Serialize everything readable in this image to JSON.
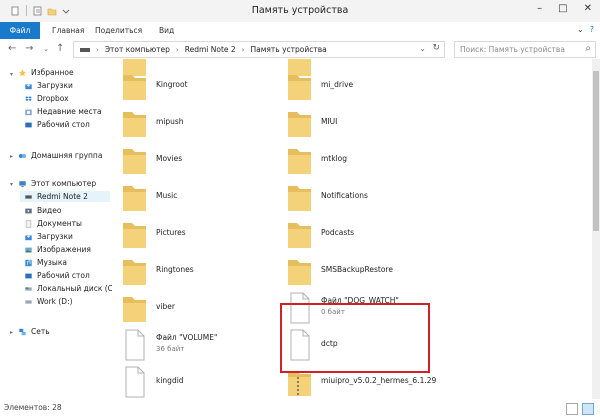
{
  "window": {
    "title": "Память устройства"
  },
  "ribbon": {
    "tabs": [
      "Файл",
      "Главная",
      "Поделиться",
      "Вид"
    ]
  },
  "address": {
    "crumbs": [
      "Этот компьютер",
      "Redmi Note 2",
      "Память устройства"
    ],
    "search_placeholder": "Поиск: Память устройства"
  },
  "nav": {
    "favorites": "Избранное",
    "fav_items": [
      "Загрузки",
      "Dropbox",
      "Недавние места",
      "Рабочий стол"
    ],
    "homegroup": "Домашняя группа",
    "computer": "Этот компьютер",
    "computer_items": [
      "Redmi Note 2",
      "Видео",
      "Документы",
      "Загрузки",
      "Изображения",
      "Музыка",
      "Рабочий стол",
      "Локальный диск (C",
      "Work (D:)"
    ],
    "network": "Сеть"
  },
  "files": {
    "col1": [
      "Kingroot",
      "mipush",
      "Movies",
      "Music",
      "Pictures",
      "Ringtones",
      "viber"
    ],
    "col2": [
      "mi_drive",
      "MIUI",
      "mtklog",
      "Notifications",
      "Podcasts",
      "SMSBackupRestore"
    ],
    "dog_watch": {
      "name": "Файл \"DOG_WATCH\"",
      "size": "0 байт"
    },
    "volume": {
      "name": "Файл \"VOLUME\"",
      "size": "36 байт"
    },
    "dctp": "dctp",
    "kingdid": "kingdid",
    "miuipro": "miuipro_v5.0.2_hermes_6.1.29"
  },
  "status": {
    "count": "Элементов: 28"
  },
  "colors": {
    "accent": "#1979ca",
    "highlight": "#d0202a",
    "folder": "#f3d27a"
  }
}
